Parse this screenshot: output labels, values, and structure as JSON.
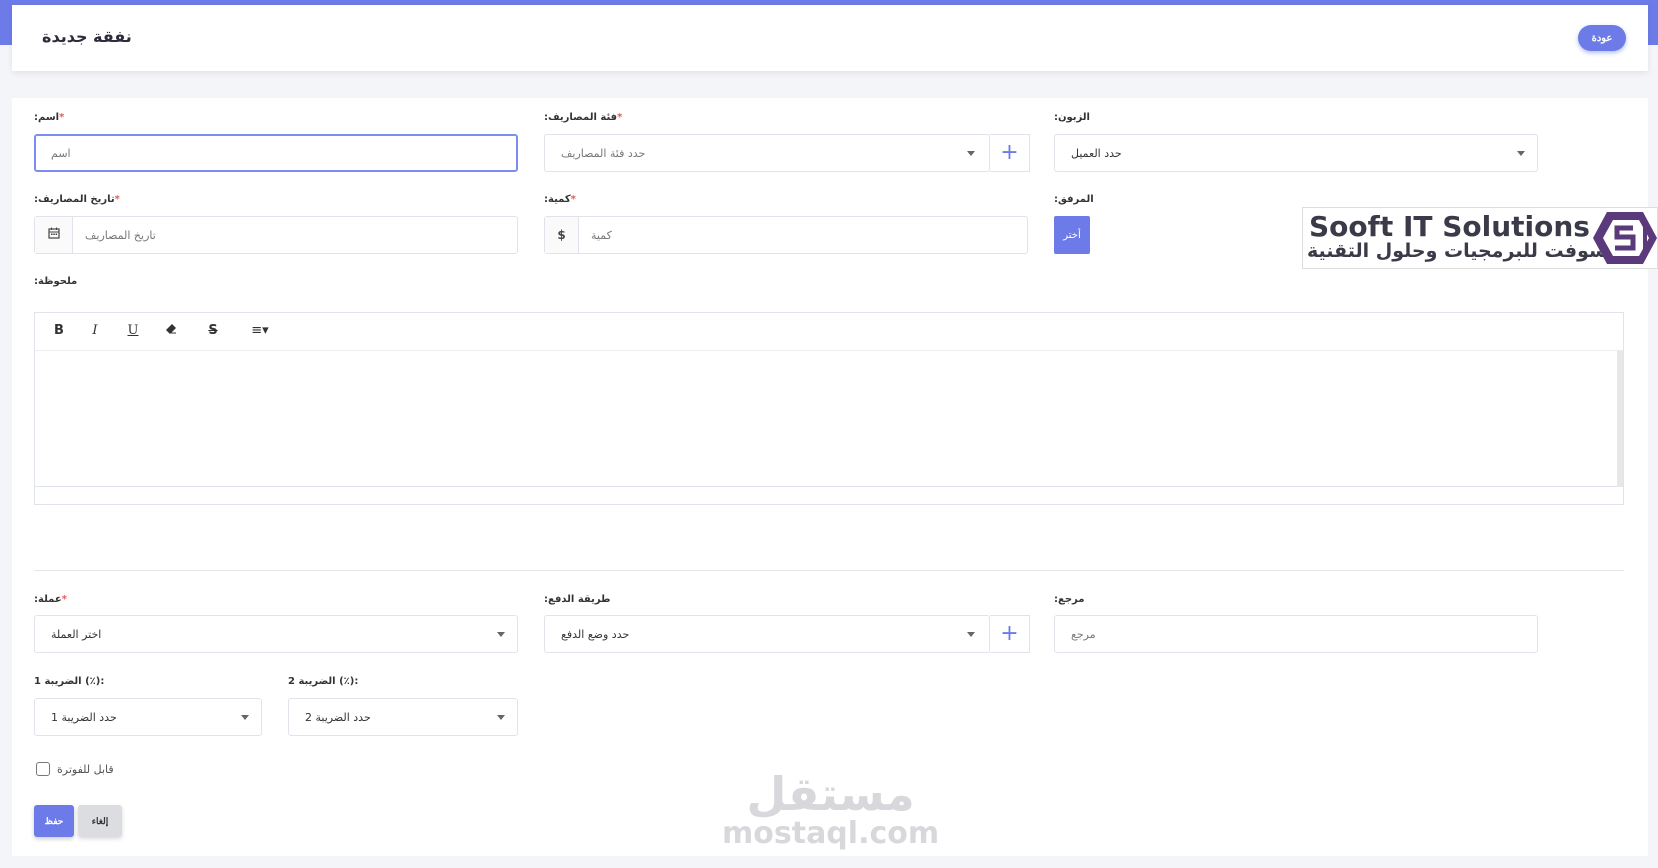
{
  "header": {
    "title": "نفقة جديدة",
    "back_label": "عودة"
  },
  "form": {
    "name": {
      "label": ":اسم",
      "required": "*",
      "placeholder": "اسم"
    },
    "category": {
      "label": ":فئة المصاريف",
      "required": "*",
      "placeholder": "حدد فئة المصاريف",
      "add": "+"
    },
    "customer": {
      "label": ":الزبون",
      "value": "حدد العميل"
    },
    "date": {
      "label": ":تاريخ المصاريف",
      "required": "*",
      "placeholder": "تاريخ المصاريف"
    },
    "amount": {
      "label": ":كمية",
      "required": "*",
      "placeholder": "كمية",
      "currency_symbol": "$"
    },
    "attachment": {
      "label": ":المرفق",
      "button": "أختر"
    },
    "note": {
      "label": ":ملحوظة",
      "toolbar": [
        "B",
        "I",
        "U",
        "",
        "S",
        "≡▾"
      ]
    },
    "currency": {
      "label": ":عملة",
      "required": "*",
      "value": "اختر العملة"
    },
    "payment_method": {
      "label": ":طريقة الدفع",
      "value": "حدد وضع الدفع",
      "add": "+"
    },
    "reference": {
      "label": ":مرجع",
      "placeholder": "مرجع"
    },
    "tax1": {
      "label": "الضريبة 1 (٪):",
      "value": "حدد الضريبة 1"
    },
    "tax2": {
      "label": "الضريبة 2 (٪):",
      "value": "حدد الضريبة 2"
    },
    "billable": {
      "label": "قابل للفوترة"
    },
    "save": "حفظ",
    "cancel": "إلغاء"
  },
  "logo": {
    "en": "Sooft IT Solutions",
    "ar": "سوفت للبرمجيات وحلول التقنية"
  },
  "watermark": {
    "ar": "مستقل",
    "en": "mostaql.com"
  },
  "colors": {
    "accent": "#6c7be8",
    "required": "#e65a5a"
  }
}
